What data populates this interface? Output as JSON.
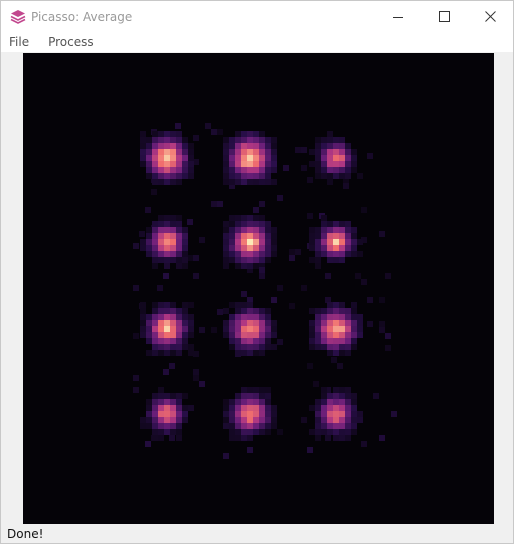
{
  "window": {
    "title": "Picasso: Average",
    "icon": "picasso-layers-icon"
  },
  "menu": {
    "items": [
      {
        "label": "File"
      },
      {
        "label": "Process"
      }
    ]
  },
  "viewer": {
    "background": "#050308",
    "colormap": "magma"
  },
  "status": {
    "text": "Done!"
  },
  "colors": {
    "accent": "#c2478e"
  }
}
